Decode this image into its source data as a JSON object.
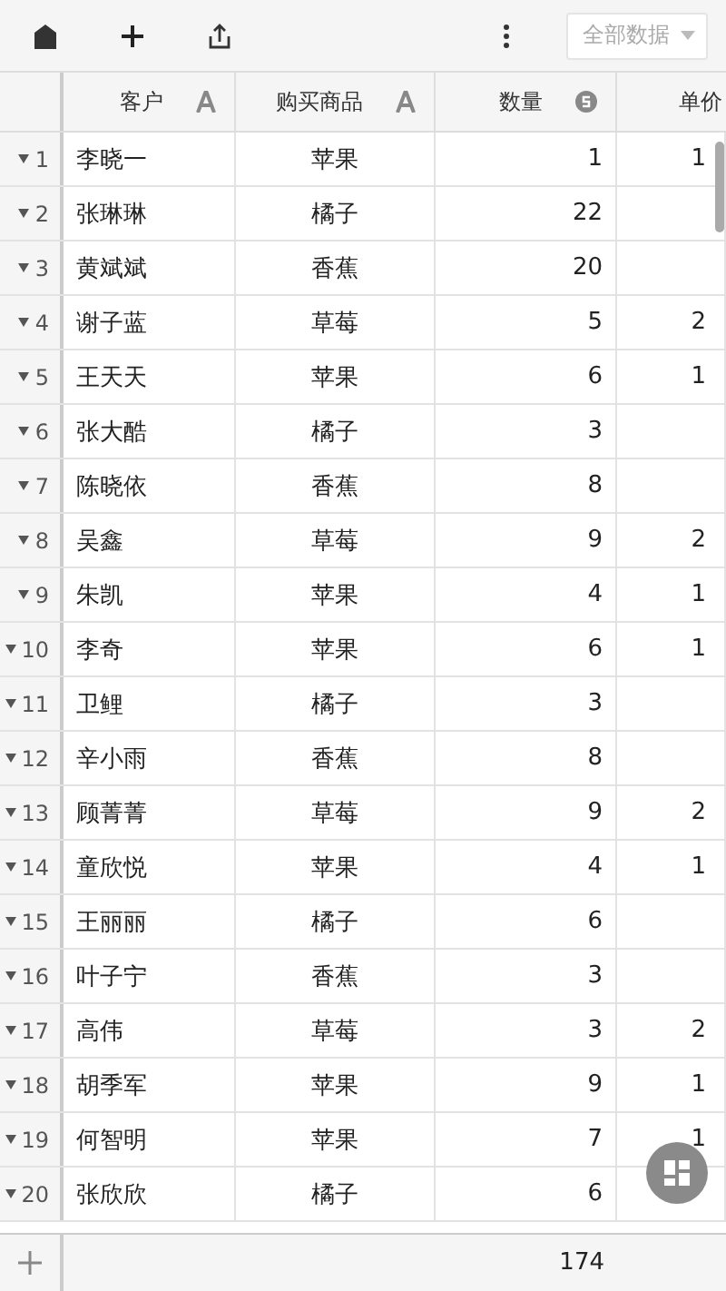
{
  "toolbar": {
    "filter": "全部数据"
  },
  "columns": [
    {
      "label": "客户",
      "kind": "text"
    },
    {
      "label": "购买商品",
      "kind": "text"
    },
    {
      "label": "数量",
      "kind": "number"
    },
    {
      "label": "单价",
      "kind": "plain"
    }
  ],
  "rows": [
    {
      "number": "1",
      "cells": [
        "李晓一",
        "苹果",
        "1",
        "1"
      ]
    },
    {
      "number": "2",
      "cells": [
        "张琳琳",
        "橘子",
        "22",
        ""
      ]
    },
    {
      "number": "3",
      "cells": [
        "黄斌斌",
        "香蕉",
        "20",
        ""
      ]
    },
    {
      "number": "4",
      "cells": [
        "谢子蓝",
        "草莓",
        "5",
        "2"
      ]
    },
    {
      "number": "5",
      "cells": [
        "王天天",
        "苹果",
        "6",
        "1"
      ]
    },
    {
      "number": "6",
      "cells": [
        "张大酷",
        "橘子",
        "3",
        ""
      ]
    },
    {
      "number": "7",
      "cells": [
        "陈晓依",
        "香蕉",
        "8",
        ""
      ]
    },
    {
      "number": "8",
      "cells": [
        "吴鑫",
        "草莓",
        "9",
        "2"
      ]
    },
    {
      "number": "9",
      "cells": [
        "朱凯",
        "苹果",
        "4",
        "1"
      ]
    },
    {
      "number": "10",
      "cells": [
        "李奇",
        "苹果",
        "6",
        "1"
      ]
    },
    {
      "number": "11",
      "cells": [
        "卫鲤",
        "橘子",
        "3",
        ""
      ]
    },
    {
      "number": "12",
      "cells": [
        "辛小雨",
        "香蕉",
        "8",
        ""
      ]
    },
    {
      "number": "13",
      "cells": [
        "顾菁菁",
        "草莓",
        "9",
        "2"
      ]
    },
    {
      "number": "14",
      "cells": [
        "童欣悦",
        "苹果",
        "4",
        "1"
      ]
    },
    {
      "number": "15",
      "cells": [
        "王丽丽",
        "橘子",
        "6",
        ""
      ]
    },
    {
      "number": "16",
      "cells": [
        "叶子宁",
        "香蕉",
        "3",
        ""
      ]
    },
    {
      "number": "17",
      "cells": [
        "高伟",
        "草莓",
        "3",
        "2"
      ]
    },
    {
      "number": "18",
      "cells": [
        "胡季军",
        "苹果",
        "9",
        "1"
      ]
    },
    {
      "number": "19",
      "cells": [
        "何智明",
        "苹果",
        "7",
        "1"
      ]
    },
    {
      "number": "20",
      "cells": [
        "张欣欣",
        "橘子",
        "6",
        ""
      ]
    }
  ],
  "footer": {
    "total": "174"
  }
}
